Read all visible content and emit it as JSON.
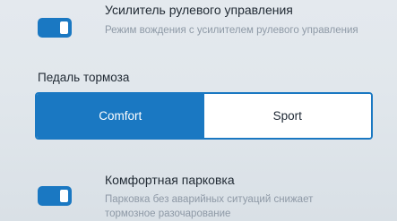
{
  "power_steering": {
    "title": "Усилитель рулевого управления",
    "description": "Режим вождения с усилителем рулевого управления",
    "enabled": true
  },
  "brake_pedal": {
    "label": "Педаль тормоза",
    "options": [
      "Comfort",
      "Sport"
    ],
    "selected": "Comfort"
  },
  "comfort_parking": {
    "title": "Комфортная парковка",
    "description": "Парковка без аварийных ситуаций снижает тормозное разочарование",
    "enabled": true
  },
  "colors": {
    "accent": "#1a78c2",
    "background": "#e2e8ed"
  }
}
